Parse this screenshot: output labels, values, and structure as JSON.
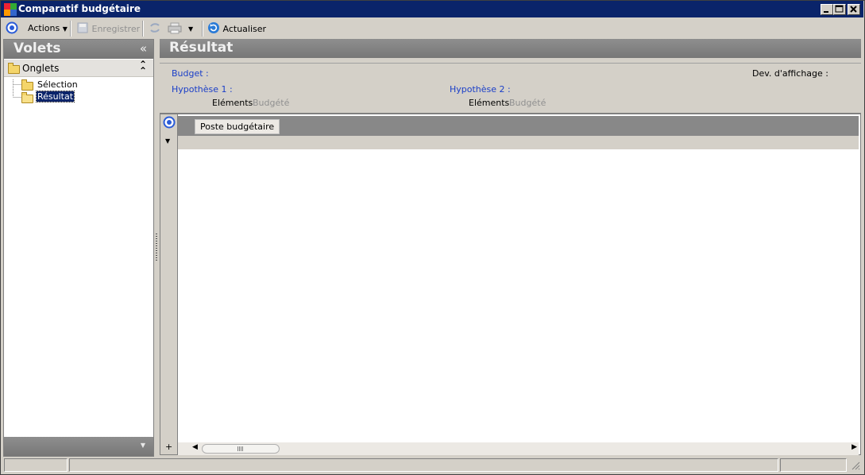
{
  "window": {
    "title": "Comparatif budgétaire"
  },
  "toolbar": {
    "actions_label": "Actions",
    "save_label": "Enregistrer",
    "refresh_label": "Actualiser"
  },
  "left_panel": {
    "title": "Volets",
    "collapse_glyph": "«",
    "group_title": "Onglets",
    "group_glyph": "⌃",
    "items": [
      {
        "label": "Sélection",
        "selected": false
      },
      {
        "label": "Résultat",
        "selected": true
      }
    ]
  },
  "main": {
    "title": "Résultat",
    "budget_label": "Budget :",
    "currency_label": "Dev. d'affichage :",
    "hypothesis1_label": "Hypothèse 1 :",
    "hypothesis2_label": "Hypothèse 2 :",
    "elements1_label": "Eléments",
    "elements1_value": "Budgété",
    "elements2_label": "Eléments",
    "elements2_value": "Budgété"
  },
  "grid": {
    "columns": [
      "Poste budgétaire"
    ],
    "add_glyph": "+"
  },
  "colors": {
    "titlebar": "#0a246a",
    "panel_header": "#808080",
    "link_blue": "#1a3ec8"
  }
}
